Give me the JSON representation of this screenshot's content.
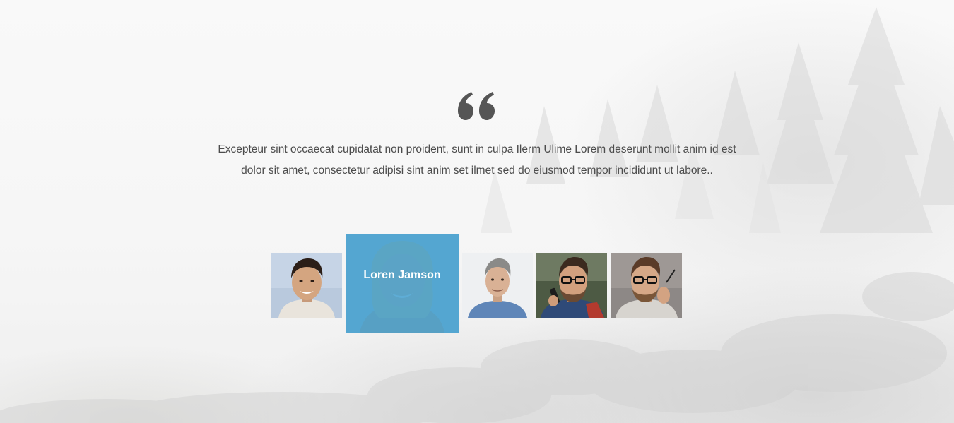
{
  "testimonial": {
    "quote_icon": "quote-left-icon",
    "text": "Excepteur sint occaecat cupidatat non proident, sunt in culpa Ilerm Ulime Lorem deserunt mollit anim id est dolor sit amet, consectetur adipisi sint anim set ilmet sed do eiusmod tempor incididunt ut labore..",
    "active_person": "Loren Jamson"
  },
  "colors": {
    "accent": "#3a9bcd",
    "text": "#4c4c4c",
    "quote_icon": "#555555"
  }
}
